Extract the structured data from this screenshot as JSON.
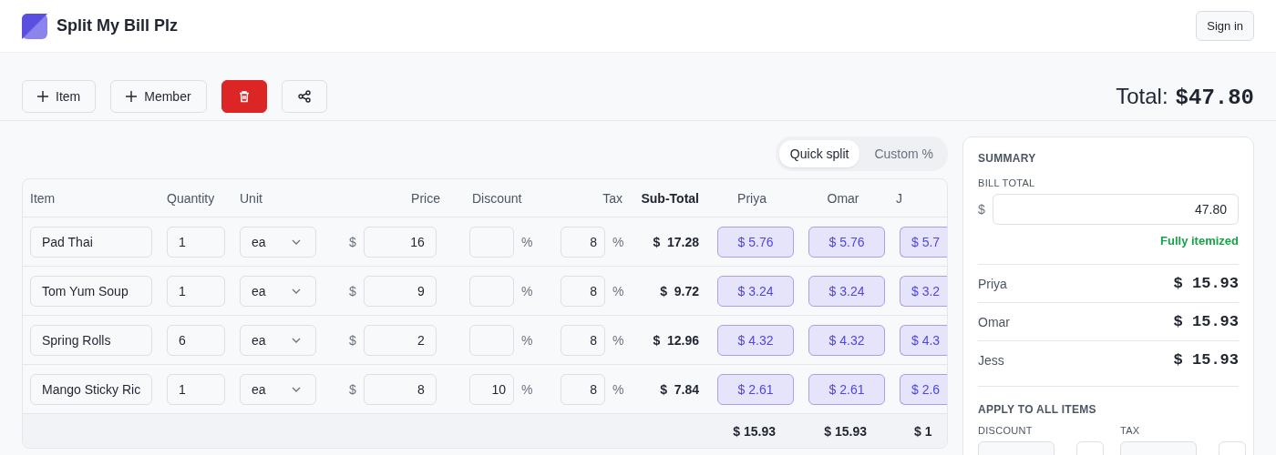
{
  "app": {
    "title": "Split My Bill Plz",
    "sign_in": "Sign in"
  },
  "toolbar": {
    "add_item": "Item",
    "add_member": "Member",
    "total_label": "Total:",
    "total_value": "$47.80"
  },
  "split_mode": [
    {
      "label": "Quick split",
      "selected": true
    },
    {
      "label": "Custom %",
      "selected": false
    }
  ],
  "table": {
    "columns": [
      "Item",
      "Quantity",
      "Unit",
      "Price",
      "Discount",
      "Tax",
      "Sub-Total"
    ],
    "members": [
      "Priya",
      "Omar",
      "J"
    ],
    "rows": [
      {
        "item": "Pad Thai",
        "quantity": "1",
        "unit": "ea",
        "currency": "$",
        "price": "16",
        "discount": "",
        "discount_unit": "%",
        "tax": "8",
        "tax_unit": "%",
        "subtotal": "$  17.28",
        "shares": [
          "$ 5.76",
          "$ 5.76",
          "$ 5.7"
        ]
      },
      {
        "item": "Tom Yum Soup",
        "quantity": "1",
        "unit": "ea",
        "currency": "$",
        "price": "9",
        "discount": "",
        "discount_unit": "%",
        "tax": "8",
        "tax_unit": "%",
        "subtotal": "$  9.72",
        "shares": [
          "$ 3.24",
          "$ 3.24",
          "$ 3.2"
        ]
      },
      {
        "item": "Spring Rolls",
        "quantity": "6",
        "unit": "ea",
        "currency": "$",
        "price": "2",
        "discount": "",
        "discount_unit": "%",
        "tax": "8",
        "tax_unit": "%",
        "subtotal": "$  12.96",
        "shares": [
          "$ 4.32",
          "$ 4.32",
          "$ 4.3"
        ]
      },
      {
        "item": "Mango Sticky Ric",
        "quantity": "1",
        "unit": "ea",
        "currency": "$",
        "price": "8",
        "discount": "10",
        "discount_unit": "%",
        "tax": "8",
        "tax_unit": "%",
        "subtotal": "$  7.84",
        "shares": [
          "$ 2.61",
          "$ 2.61",
          "$ 2.6"
        ]
      }
    ],
    "footer": [
      "$ 15.93",
      "$ 15.93",
      "$ 1"
    ]
  },
  "summary": {
    "title": "SUMMARY",
    "bill_total_label": "BILL TOTAL",
    "currency": "$",
    "bill_total": "47.80",
    "status": "Fully itemized",
    "people": [
      {
        "name": "Priya",
        "amount": "$ 15.93"
      },
      {
        "name": "Omar",
        "amount": "$ 15.93"
      },
      {
        "name": "Jess",
        "amount": "$ 15.93"
      }
    ],
    "apply_title": "APPLY TO ALL ITEMS",
    "discount_label": "DISCOUNT",
    "tax_label": "TAX"
  }
}
